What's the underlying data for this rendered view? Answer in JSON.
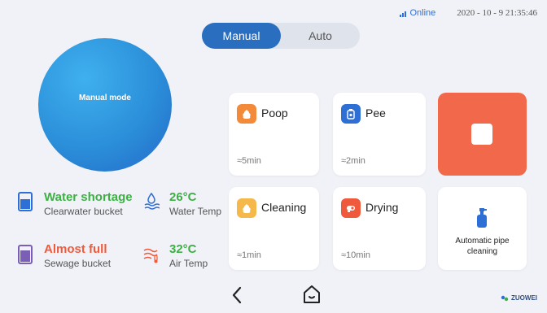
{
  "status": {
    "network": "Online",
    "datetime": "2020 - 10 -  9   21:35:46"
  },
  "mode_toggle": {
    "manual": "Manual",
    "auto": "Auto",
    "active": "manual"
  },
  "mode_circle": {
    "label": "Manual mode"
  },
  "cards": {
    "poop": {
      "title": "Poop",
      "time": "≈5min"
    },
    "pee": {
      "title": "Pee",
      "time": "≈2min"
    },
    "cleaning": {
      "title": "Cleaning",
      "time": "≈1min"
    },
    "drying": {
      "title": "Drying",
      "time": "≈10min"
    },
    "pipe": {
      "label_line1": "Automatic pipe",
      "label_line2": "cleaning"
    }
  },
  "stats": {
    "clearwater": {
      "value": "Water shortage",
      "label": "Clearwater bucket"
    },
    "water_temp": {
      "value": "26°C",
      "label": "Water Temp"
    },
    "sewage": {
      "value": "Almost full",
      "label": "Sewage bucket"
    },
    "air_temp": {
      "value": "32°C",
      "label": "Air Temp"
    }
  },
  "brand": {
    "name": "ZUOWEI"
  },
  "colors": {
    "accent": "#2a6fbf",
    "stop": "#f2684a",
    "green": "#3cb043",
    "red": "#f05a3c",
    "poop_icon": "#f28a3a",
    "pee_icon": "#2e6fd6",
    "cleaning_icon": "#f5b84a",
    "drying_icon": "#f05a3c"
  },
  "icons": {
    "poop": "poop-icon",
    "pee": "pee-icon",
    "cleaning": "cleaning-icon",
    "drying": "drying-icon",
    "stop": "stop-icon",
    "pipe": "spray-bottle-icon",
    "back": "back-arrow-icon",
    "home": "home-icon"
  }
}
